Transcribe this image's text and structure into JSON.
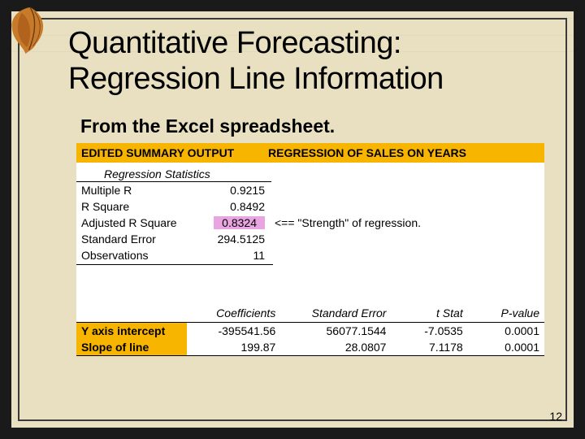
{
  "title_line1": "Quantitative Forecasting:",
  "title_line2": "Regression Line Information",
  "subtitle": "From the Excel spreadsheet.",
  "header": {
    "left": "EDITED SUMMARY OUTPUT",
    "right": "REGRESSION OF SALES ON YEARS"
  },
  "stats_heading": "Regression Statistics",
  "stats": [
    {
      "label": "Multiple R",
      "value": "0.9215",
      "note": ""
    },
    {
      "label": "R Square",
      "value": "0.8492",
      "note": ""
    },
    {
      "label": "Adjusted R Square",
      "value": "0.8324",
      "note": "<== \"Strength\" of regression.",
      "highlight": true
    },
    {
      "label": "Standard Error",
      "value": "294.5125",
      "note": ""
    },
    {
      "label": "Observations",
      "value": "11",
      "note": ""
    }
  ],
  "coef_headers": [
    "",
    "Coefficients",
    "Standard Error",
    "t Stat",
    "P-value"
  ],
  "coef_rows": [
    {
      "label": "Y axis intercept",
      "coef": "-395541.56",
      "se": "56077.1544",
      "t": "-7.0535",
      "p": "0.0001"
    },
    {
      "label": "Slope of line",
      "coef": "199.87",
      "se": "28.0807",
      "t": "7.1178",
      "p": "0.0001"
    }
  ],
  "chart_data": {
    "type": "table",
    "title": "Regression of Sales on Years — Summary Output",
    "regression_statistics": {
      "Multiple R": 0.9215,
      "R Square": 0.8492,
      "Adjusted R Square": 0.8324,
      "Standard Error": 294.5125,
      "Observations": 11
    },
    "coefficients": [
      {
        "term": "Y axis intercept",
        "coefficient": -395541.56,
        "standard_error": 56077.1544,
        "t_stat": -7.0535,
        "p_value": 0.0001
      },
      {
        "term": "Slope of line",
        "coefficient": 199.87,
        "standard_error": 28.0807,
        "t_stat": 7.1178,
        "p_value": 0.0001
      }
    ],
    "annotation": "Adjusted R Square indicates strength of regression"
  },
  "page_number": "12"
}
